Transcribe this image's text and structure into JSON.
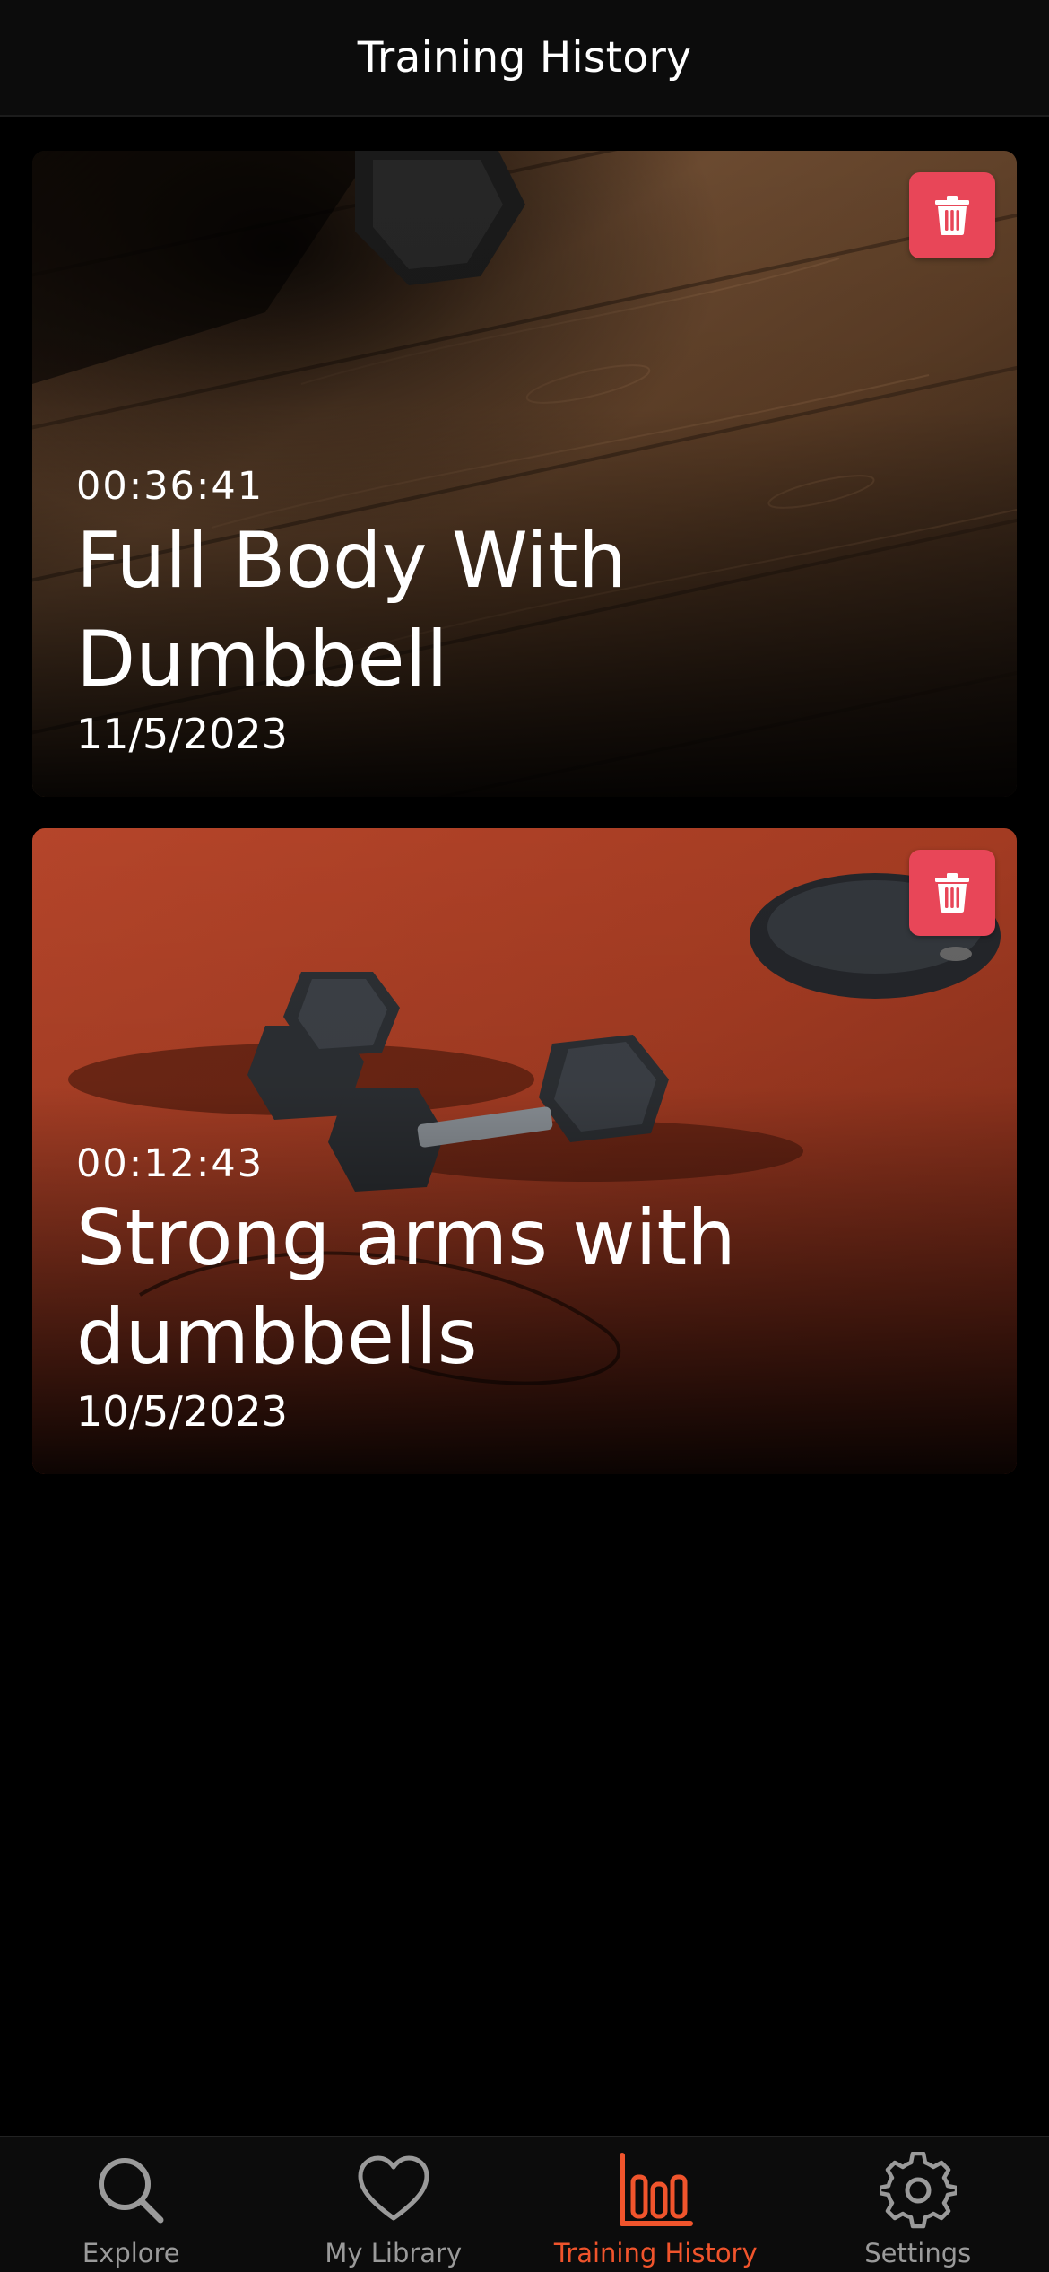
{
  "header": {
    "title": "Training History"
  },
  "workouts": [
    {
      "duration": "00:36:41",
      "title": "Full Body With Dumbbell",
      "date": "11/5/2023"
    },
    {
      "duration": "00:12:43",
      "title": "Strong arms with dumbbells",
      "date": "10/5/2023"
    }
  ],
  "tabs": [
    {
      "label": "Explore",
      "icon": "search-icon"
    },
    {
      "label": "My Library",
      "icon": "heart-icon"
    },
    {
      "label": "Training History",
      "icon": "bar-chart-icon",
      "active": true
    },
    {
      "label": "Settings",
      "icon": "gear-icon"
    }
  ],
  "colors": {
    "accent": "#f0542c",
    "delete": "#e84658",
    "inactive": "#9a9a9a",
    "background": "#000000"
  }
}
